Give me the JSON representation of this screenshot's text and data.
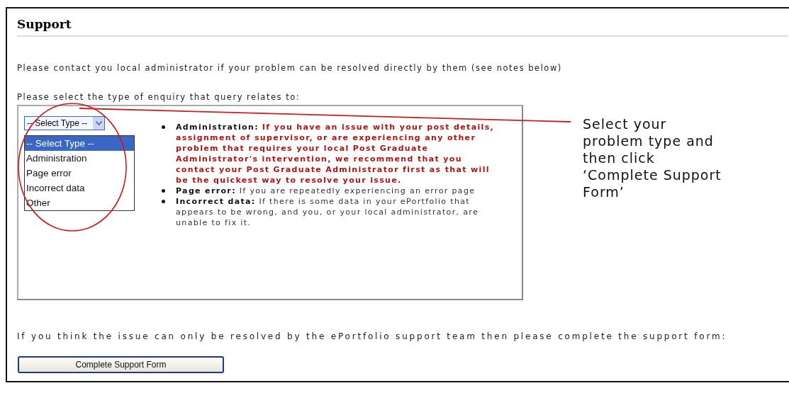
{
  "title": "Support",
  "intro": "Please contact you local administrator if your problem can be resolved directly by them (see notes below)",
  "prompt": "Please select the type of enquiry that query relates to:",
  "enquiry_select": {
    "value": "-- Select Type --",
    "expanded": true,
    "options": [
      {
        "label": "-- Select Type --",
        "selected": true
      },
      {
        "label": "Administration",
        "selected": false
      },
      {
        "label": "Page error",
        "selected": false
      },
      {
        "label": "Incorrect data",
        "selected": false
      },
      {
        "label": "Other",
        "selected": false
      }
    ]
  },
  "notes": [
    {
      "term": "Administration:",
      "text": "If you have an issue with your post details, assignment of supervisor, or are experiencing any other problem that requires your local Post Graduate Administrator's intervention, we recommend that you contact your Post Graduate Administrator first as that will be the quickest way to resolve your issue.",
      "kind": "warning"
    },
    {
      "term": "Page error:",
      "text": "If you are repeatedly experiencing an error page",
      "kind": "normal"
    },
    {
      "term": "Incorrect data:",
      "text": "If there is some data in your ePortfolio that appears to be wrong, and you, or your local administrator, are unable to fix it.",
      "kind": "normal"
    }
  ],
  "closing": "If you think the issue can only be resolved by the ePortfolio support team then please complete the support form:",
  "button": "Complete Support Form",
  "annotation": {
    "text": "Select your problem type and then click ‘Complete Support Form’"
  }
}
